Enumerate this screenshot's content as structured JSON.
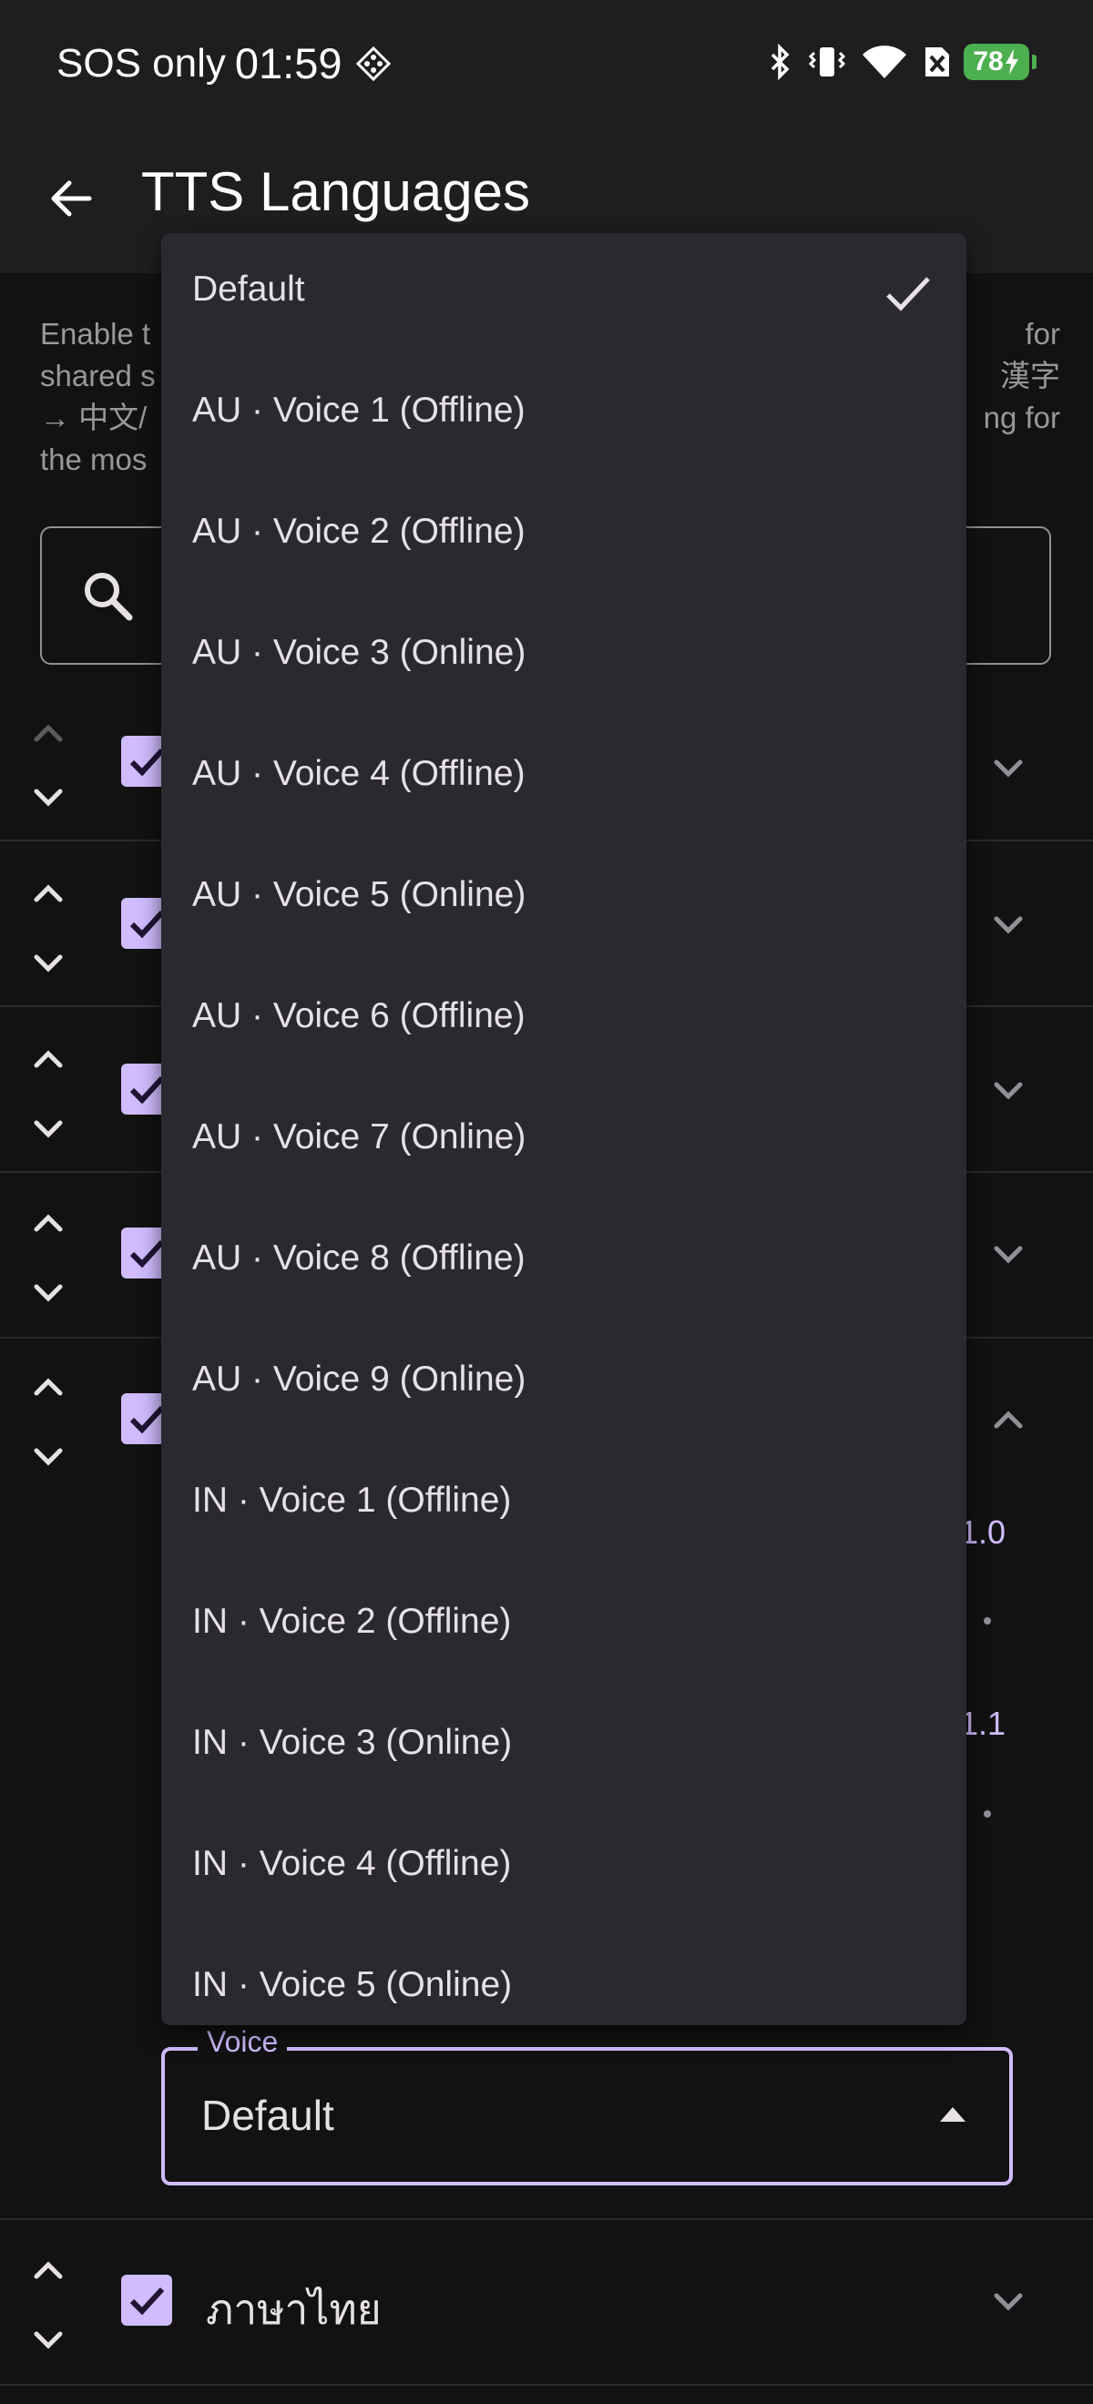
{
  "status_bar": {
    "carrier": "SOS only",
    "time": "01:59",
    "battery": "78"
  },
  "app_bar": {
    "title": "TTS Languages"
  },
  "description": {
    "left_lines": [
      "Enable t",
      "shared s",
      "→ 中文/",
      "the mos"
    ],
    "right_lines": [
      "for",
      "漢字",
      "ng for",
      ""
    ]
  },
  "rows": [
    {
      "label": "",
      "checked": true
    },
    {
      "label": "",
      "checked": true
    },
    {
      "label": "",
      "checked": true
    },
    {
      "label": "",
      "checked": true
    },
    {
      "label": "",
      "checked": true
    },
    {
      "label": "ภาษาไทย",
      "checked": true
    }
  ],
  "speech_values": {
    "rate": "1.0",
    "pitch": "1.1"
  },
  "voice_field": {
    "label": "Voice",
    "value": "Default"
  },
  "menu": {
    "items": [
      {
        "label": "Default",
        "selected": true
      },
      {
        "label": "AU · Voice 1 (Offline)"
      },
      {
        "label": "AU · Voice 2 (Offline)"
      },
      {
        "label": "AU · Voice 3 (Online)"
      },
      {
        "label": "AU · Voice 4 (Offline)"
      },
      {
        "label": "AU · Voice 5 (Online)"
      },
      {
        "label": "AU · Voice 6 (Offline)"
      },
      {
        "label": "AU · Voice 7 (Online)"
      },
      {
        "label": "AU · Voice 8 (Offline)"
      },
      {
        "label": "AU · Voice 9 (Online)"
      },
      {
        "label": "IN · Voice 1 (Offline)"
      },
      {
        "label": "IN · Voice 2 (Offline)"
      },
      {
        "label": "IN · Voice 3 (Online)"
      },
      {
        "label": "IN · Voice 4 (Offline)"
      },
      {
        "label": "IN · Voice 5 (Online)"
      }
    ]
  }
}
